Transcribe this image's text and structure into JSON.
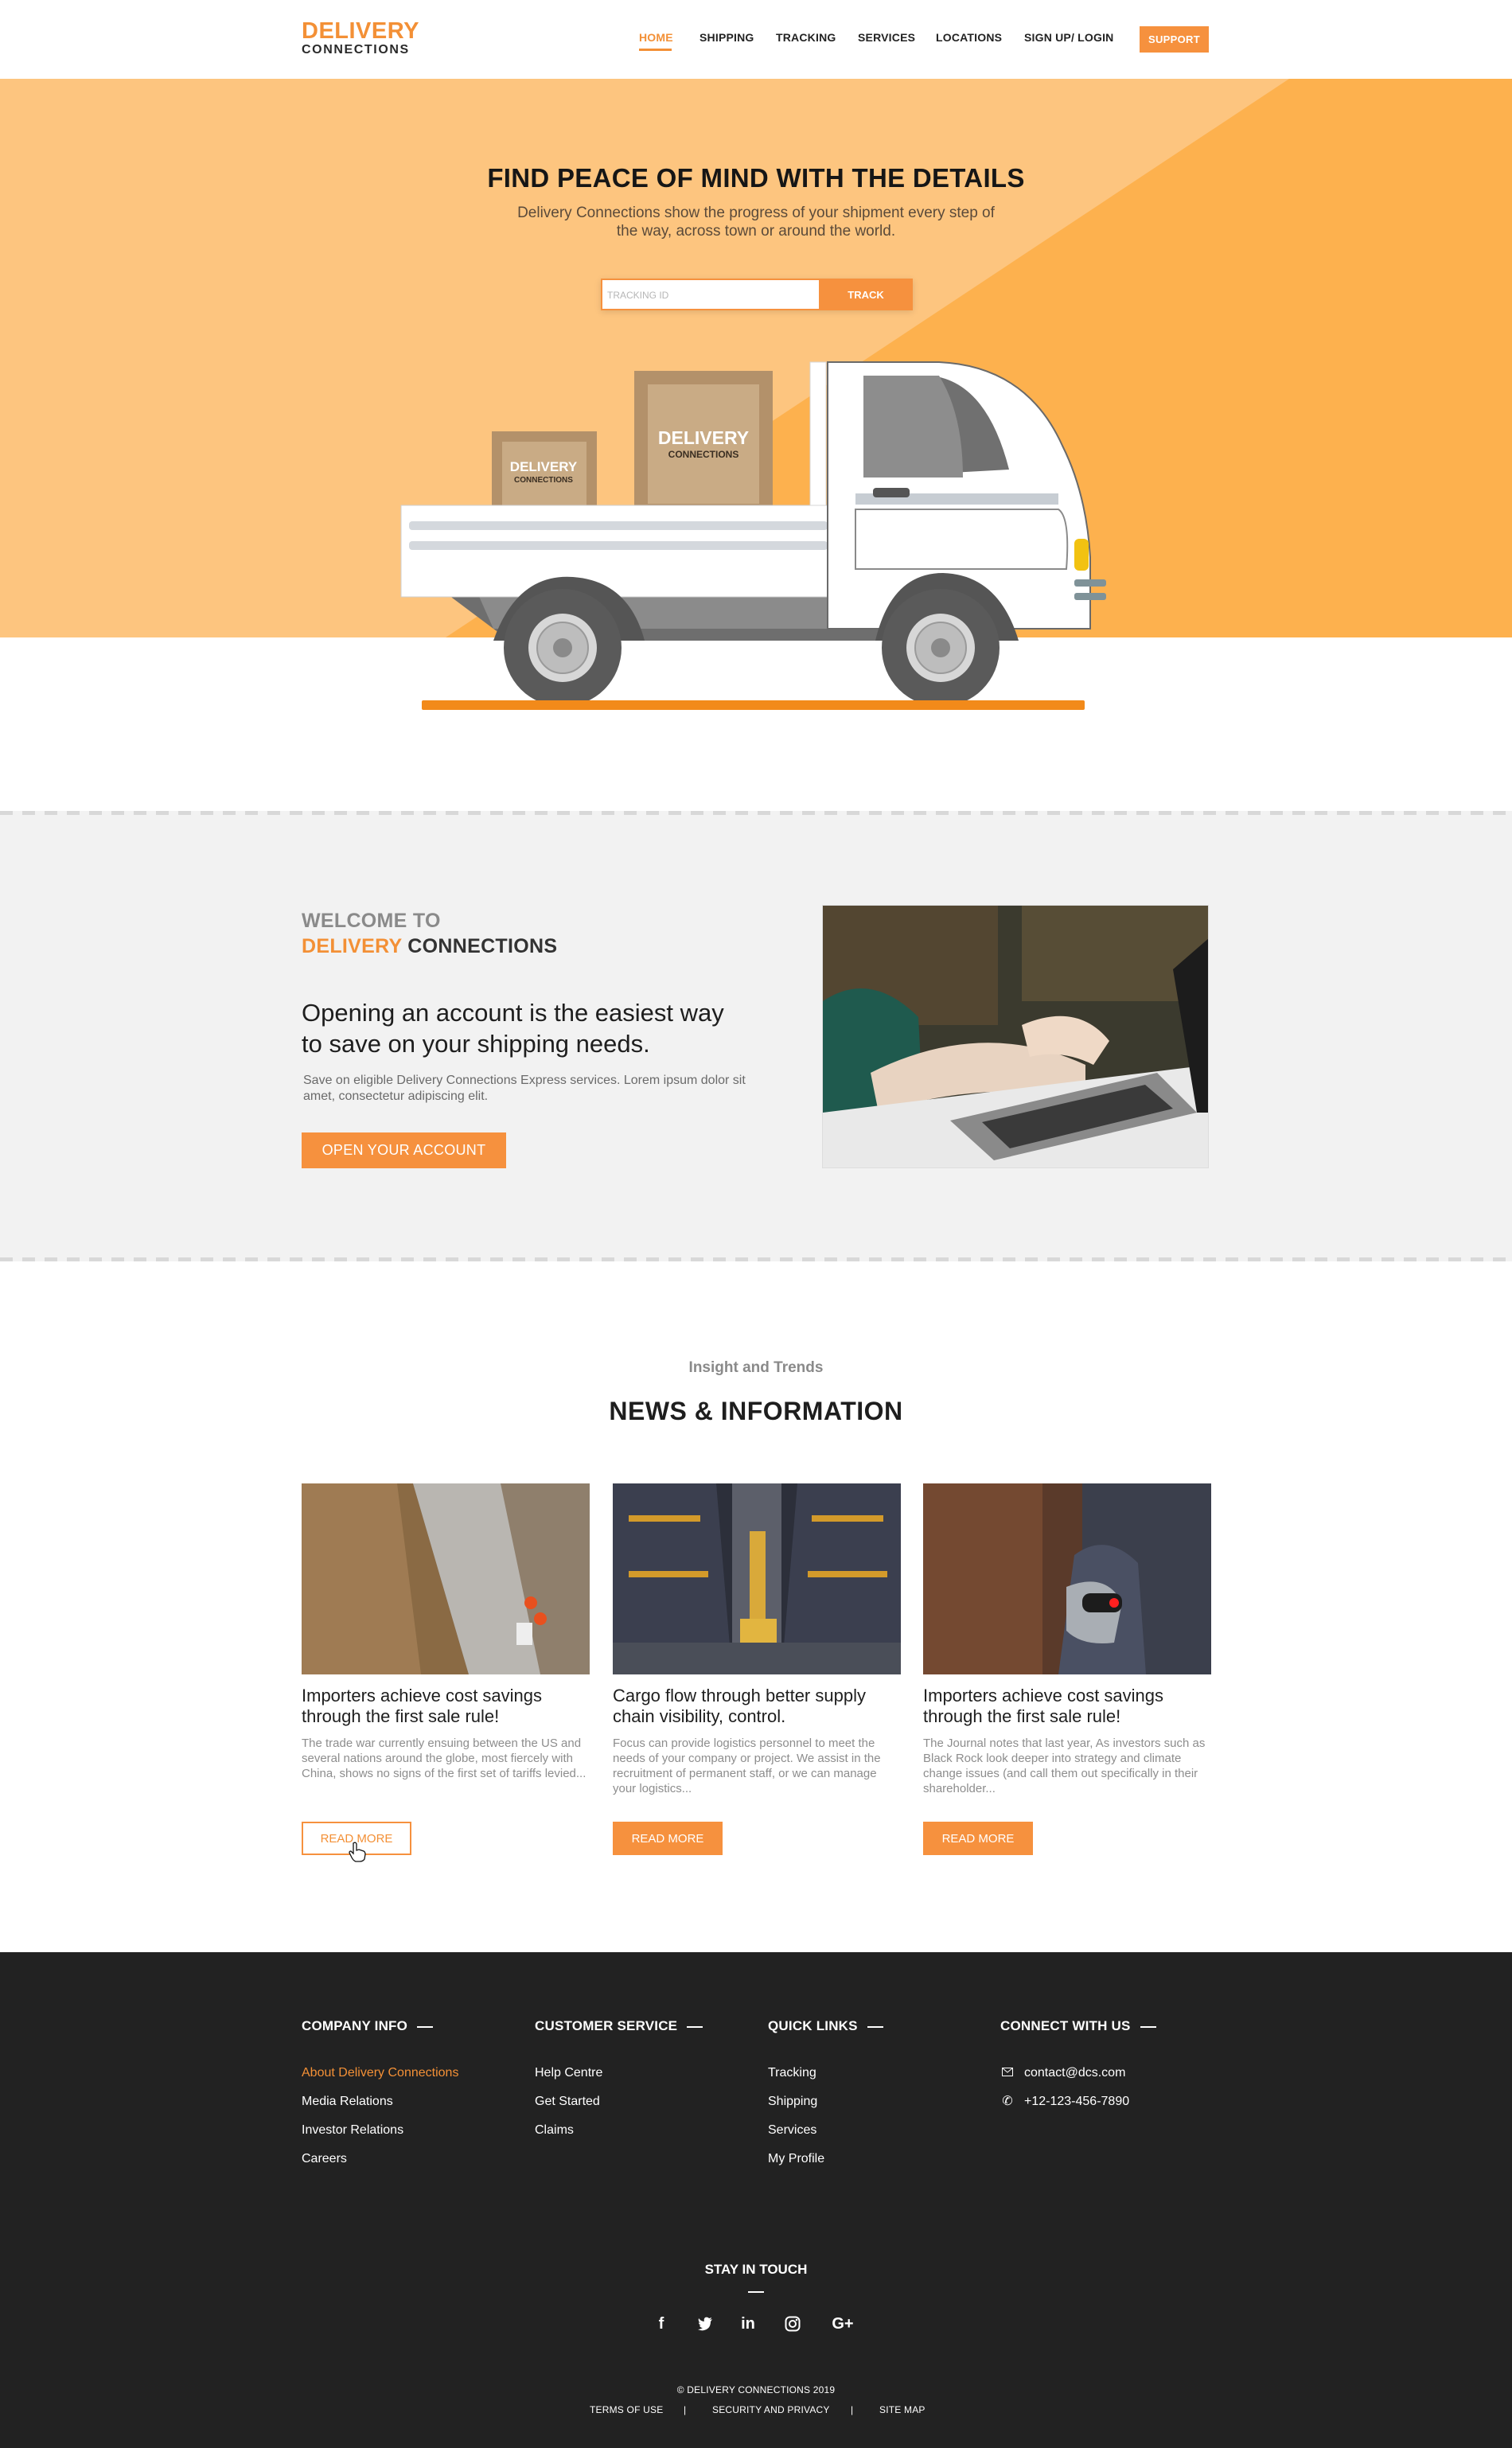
{
  "brand": {
    "name_line1": "DELIVERY",
    "name_line2": "CONNECTIONS",
    "accent_color": "#f39036"
  },
  "nav": {
    "items": [
      "HOME",
      "SHIPPING",
      "TRACKING",
      "SERVICES",
      "LOCATIONS",
      "SIGN UP/ LOGIN"
    ],
    "active": "HOME",
    "support_label": "SUPPORT"
  },
  "hero": {
    "title": "FIND PEACE OF MIND WITH THE DETAILS",
    "subtitle": "Delivery Connections show the progress of your shipment every step of the way, across town or around the world.",
    "tracking_placeholder": "TRACKING ID",
    "track_label": "TRACK",
    "box_large_line1": "DELIVERY",
    "box_large_line2": "CONNECTIONS",
    "box_small_line1": "DELIVERY",
    "box_small_line2": "CONNECTIONS"
  },
  "welcome": {
    "title_line1": "WELCOME TO",
    "title_accent": "DELIVERY",
    "title_rest": " CONNECTIONS",
    "headline": "Opening an account is the easiest way to save on your shipping needs.",
    "body": "Save on eligible Delivery Connections Express services. Lorem ipsum dolor sit amet, consectetur adipiscing elit.",
    "cta_label": "OPEN YOUR ACCOUNT"
  },
  "news": {
    "kicker": "Insight and Trends",
    "title": "NEWS & INFORMATION",
    "cards": [
      {
        "title": "Importers achieve cost savings through the first sale rule!",
        "excerpt": "The trade war currently ensuing between the US and several nations around the globe, most fiercely with China, shows no signs of the first set of tariffs levied...",
        "button": "READ MORE"
      },
      {
        "title": "Cargo flow through better supply chain visibility, control.",
        "excerpt": "Focus can provide logistics personnel to meet the needs of your company or project. We assist in the recruitment of permanent staff, or we can manage your logistics...",
        "button": "READ MORE"
      },
      {
        "title": "Importers achieve cost savings through the first sale rule!",
        "excerpt": "The Journal notes that last year, As investors such as Black Rock look deeper into strategy and climate change issues (and call them out specifically in their shareholder...",
        "button": "READ MORE"
      }
    ]
  },
  "footer": {
    "company_info": {
      "heading": "COMPANY INFO",
      "links": [
        "About Delivery Connections",
        "Media Relations",
        "Investor Relations",
        "Careers"
      ]
    },
    "customer_service": {
      "heading": "CUSTOMER SERVICE",
      "links": [
        "Help Centre",
        "Get Started",
        "Claims"
      ]
    },
    "quick_links": {
      "heading": "QUICK LINKS",
      "links": [
        "Tracking",
        "Shipping",
        "Services",
        "My Profile"
      ]
    },
    "connect": {
      "heading": "CONNECT WITH US",
      "email": "contact@dcs.com",
      "phone": "+12-123-456-7890"
    },
    "stay_in_touch": "STAY IN TOUCH",
    "social": [
      "f",
      "twitter-icon",
      "in",
      "instagram-icon",
      "G+"
    ],
    "copyright": "©  DELIVERY CONNECTIONS  2019",
    "bottom_links": [
      "TERMS OF USE",
      "SECURITY AND PRIVACY",
      "SITE MAP"
    ],
    "separator": "|",
    "background": "#222222"
  }
}
